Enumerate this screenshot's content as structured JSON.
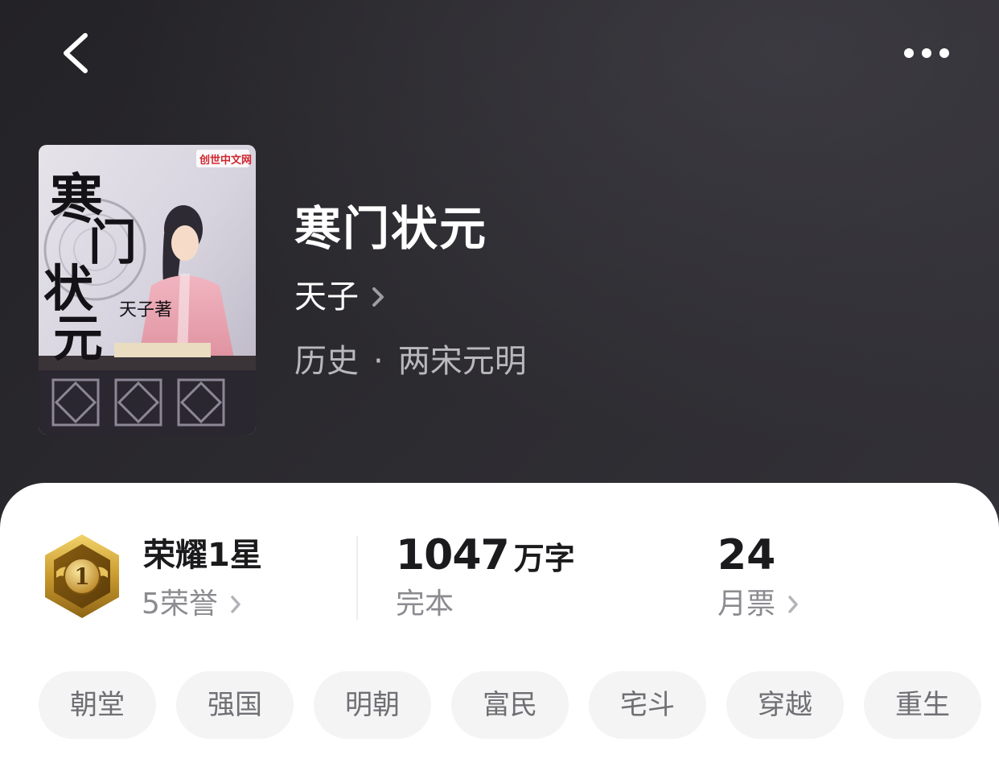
{
  "nav": {
    "back_icon": "chevron-left-icon",
    "more_icon": "more-horizontal-icon"
  },
  "book": {
    "title": "寒门状元",
    "author": "天子",
    "category": "历史",
    "separator": "·",
    "subcategory": "两宋元明",
    "cover": {
      "title_text": "寒门状元",
      "author_text": "天子著",
      "publisher_logo": "创世中文网"
    }
  },
  "stats": {
    "honor": {
      "title": "荣耀1星",
      "count_label": "5荣誉",
      "badge_text": "1",
      "badge_icon": "gold-medal-icon"
    },
    "words": {
      "value": "1047",
      "unit": "万字",
      "status": "完本"
    },
    "votes": {
      "value": "24",
      "label": "月票"
    }
  },
  "tags": [
    "朝堂",
    "强国",
    "明朝",
    "富民",
    "宅斗",
    "穿越",
    "重生"
  ],
  "colors": {
    "header_bg": "#2a292e",
    "card_bg": "#ffffff",
    "tag_bg": "#f4f4f5",
    "muted_text": "#8b8b90",
    "gold": "#c9a338"
  }
}
